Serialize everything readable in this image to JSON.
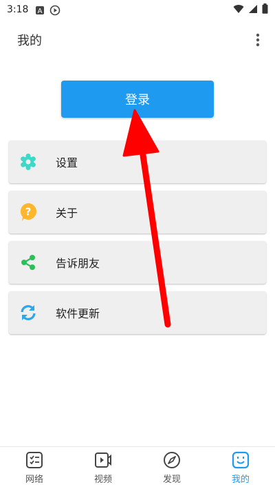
{
  "status_bar": {
    "time": "3:18",
    "icons": [
      "notification-a-icon",
      "play-circle-icon",
      "wifi-icon",
      "signal-icon",
      "battery-icon"
    ]
  },
  "app_bar": {
    "title": "我的",
    "more_icon": "more-vert-icon"
  },
  "login_button": {
    "label": "登录",
    "color": "#1e9bf0"
  },
  "menu": {
    "items": [
      {
        "label": "设置",
        "icon": "gear-icon",
        "color": "#3dd8c8"
      },
      {
        "label": "关于",
        "icon": "question-bubble-icon",
        "color": "#fdb62d"
      },
      {
        "label": "告诉朋友",
        "icon": "share-icon",
        "color": "#2bbf5a"
      },
      {
        "label": "软件更新",
        "icon": "refresh-icon",
        "color": "#2aa8ec"
      }
    ]
  },
  "annotation": {
    "arrow_color": "#ff0000"
  },
  "bottom_nav": {
    "items": [
      {
        "label": "网络",
        "icon": "network-list-icon",
        "active": false
      },
      {
        "label": "视频",
        "icon": "video-icon",
        "active": false
      },
      {
        "label": "发现",
        "icon": "compass-icon",
        "active": false
      },
      {
        "label": "我的",
        "icon": "smiley-box-icon",
        "active": true
      }
    ],
    "active_color": "#1e9bf0"
  }
}
